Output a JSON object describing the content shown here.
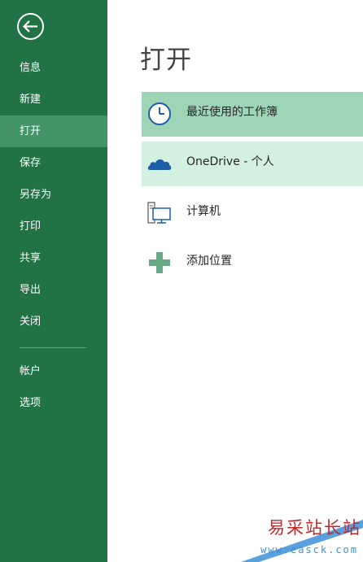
{
  "sidebar": {
    "items": [
      {
        "label": "信息"
      },
      {
        "label": "新建"
      },
      {
        "label": "打开"
      },
      {
        "label": "保存"
      },
      {
        "label": "另存为"
      },
      {
        "label": "打印"
      },
      {
        "label": "共享"
      },
      {
        "label": "导出"
      },
      {
        "label": "关闭"
      },
      {
        "label": "帐户"
      },
      {
        "label": "选项"
      }
    ],
    "selected": "打开"
  },
  "main": {
    "title": "打开",
    "places": [
      {
        "label": "最近使用的工作簿",
        "icon": "clock-icon",
        "state": "selected"
      },
      {
        "label": "OneDrive - 个人",
        "icon": "cloud-icon",
        "state": "hover"
      },
      {
        "label": "计算机",
        "icon": "computer-icon",
        "state": "normal"
      },
      {
        "label": "添加位置",
        "icon": "plus-icon",
        "state": "normal"
      }
    ]
  },
  "watermark": {
    "title": "易采站长站",
    "url": "www.easck.com"
  },
  "colors": {
    "sidebar_bg": "#217346",
    "sidebar_selected": "#439467",
    "place_selected": "#9fd5b7",
    "place_hover": "#d3f0e0",
    "icon_blue": "#1e5ea8",
    "plus_green": "#6aa987"
  }
}
